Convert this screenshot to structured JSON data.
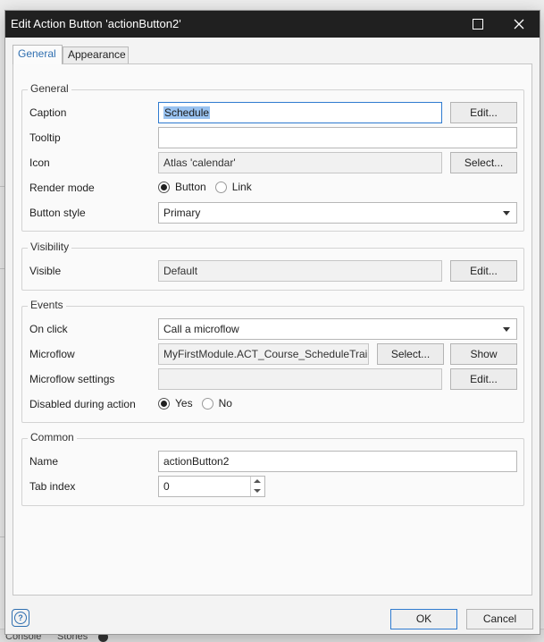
{
  "window": {
    "title": "Edit Action Button 'actionButton2'"
  },
  "tabs": [
    {
      "label": "General",
      "active": true
    },
    {
      "label": "Appearance",
      "active": false
    }
  ],
  "general": {
    "legend": "General",
    "caption": {
      "label": "Caption",
      "value": "Schedule",
      "button": "Edit..."
    },
    "tooltip": {
      "label": "Tooltip",
      "value": ""
    },
    "icon": {
      "label": "Icon",
      "value": "Atlas 'calendar'",
      "button": "Select..."
    },
    "render_mode": {
      "label": "Render mode",
      "options": [
        "Button",
        "Link"
      ],
      "selected": "Button"
    },
    "button_style": {
      "label": "Button style",
      "value": "Primary"
    }
  },
  "visibility": {
    "legend": "Visibility",
    "visible": {
      "label": "Visible",
      "value": "Default",
      "button": "Edit..."
    }
  },
  "events": {
    "legend": "Events",
    "on_click": {
      "label": "On click",
      "value": "Call a microflow"
    },
    "microflow": {
      "label": "Microflow",
      "value": "MyFirstModule.ACT_Course_ScheduleTrair",
      "select_button": "Select...",
      "show_button": "Show"
    },
    "microflow_settings": {
      "label": "Microflow settings",
      "value": "",
      "button": "Edit..."
    },
    "disabled_during_action": {
      "label": "Disabled during action",
      "options": [
        "Yes",
        "No"
      ],
      "selected": "Yes"
    }
  },
  "common": {
    "legend": "Common",
    "name": {
      "label": "Name",
      "value": "actionButton2"
    },
    "tab_index": {
      "label": "Tab index",
      "value": "0"
    }
  },
  "footer": {
    "ok": "OK",
    "cancel": "Cancel",
    "help": "?"
  },
  "background": {
    "console_tab": "Console",
    "stories_tab": "Stories"
  }
}
